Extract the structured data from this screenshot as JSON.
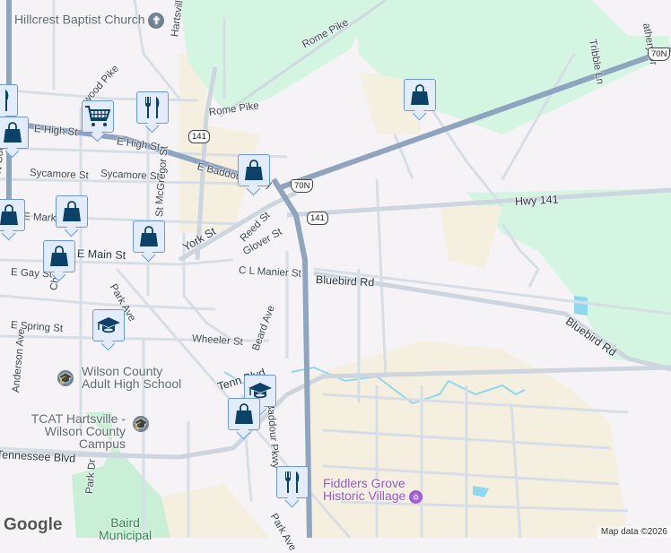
{
  "colors": {
    "background": "#f5f3f5",
    "park": "#d3f5e1",
    "urban": "#f5efe0",
    "highway": "#8fa4bf",
    "road": "#d4dbe3",
    "water": "#8fd8ef",
    "marker_fill": "#e3ecfb",
    "marker_border": "#6a98e3",
    "marker_icon": "#0d4268"
  },
  "streets": {
    "e_high_1": "E High St",
    "e_high_2": "E High St",
    "e_baddour": "E Baddour Pkwy",
    "e_baddour_s": "E Baddour Pkwy",
    "sycamore_1": "Sycamore St",
    "sycamore_2": "Sycamore St",
    "hartsville": "Hartsville Pike",
    "rome_pike": "Rome Pike",
    "rome_pike_2": "Rome Pike",
    "hwy141": "Hwy 141",
    "bluebird": "Bluebird Rd",
    "bluebird_2": "Bluebird Rd",
    "york": "York St",
    "reed": "Reed St",
    "glover": "Glover St",
    "cl_manier": "C L Manier St",
    "e_main": "E Main St",
    "e_market": "E Marke",
    "e_gay": "E Gay St",
    "cherry": "Cherry St",
    "park_ave": "Park Ave",
    "park_ave_s": "Park Ave",
    "e_spring": "E Spring St",
    "wheeler": "Wheeler St",
    "beard": "Beard Ave",
    "anderson": "Anderson Ave",
    "tennessee": "Tennessee Blvd",
    "tenn_blvd": "Tenn    Blvd",
    "park_dr": "Park Dr",
    "mcgregor": "McGregor St",
    "n_college": "N College",
    "wood_pike": "wood Pike",
    "tribble": "Tribble Ln",
    "athery": "athery Dr",
    "st_short": "St"
  },
  "shields": {
    "r141_a": "141",
    "r141_b": "141",
    "us70n_a": "70N",
    "us70n_b": "70N"
  },
  "pois": {
    "church": "Hillcrest Baptist Church",
    "adult_school_1": "Wilson County",
    "adult_school_2": "Adult High School",
    "tcat_1": "TCAT Hartsville -",
    "tcat_2": "Wilson County Campus",
    "fiddlers_1": "Fiddlers Grove",
    "fiddlers_2": "Historic Village",
    "baird_1": "Baird",
    "baird_2": "Municipal"
  },
  "markers": [
    {
      "type": "shopping-bag"
    },
    {
      "type": "restaurant"
    },
    {
      "type": "shopping-cart"
    },
    {
      "type": "shopping-bag"
    },
    {
      "type": "shopping-bag"
    },
    {
      "type": "shopping-bag"
    },
    {
      "type": "shopping-bag"
    },
    {
      "type": "shopping-bag"
    },
    {
      "type": "school"
    },
    {
      "type": "school"
    },
    {
      "type": "shopping-bag"
    },
    {
      "type": "restaurant"
    }
  ],
  "attribution": {
    "logo": "Google",
    "map_data": "Map data ©2026"
  }
}
